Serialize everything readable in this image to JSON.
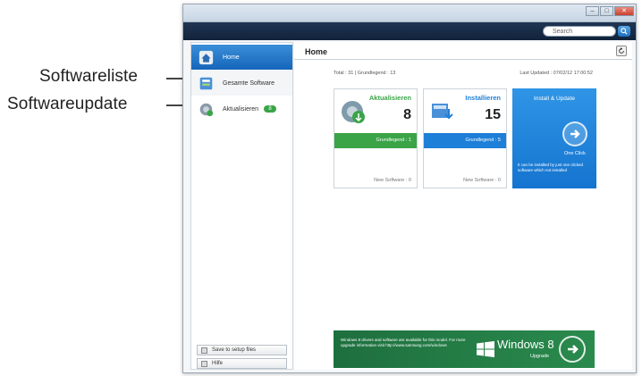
{
  "callouts": {
    "software_list": "Softwareliste",
    "software_update": "Softwareupdate"
  },
  "window": {
    "search_placeholder": "Search"
  },
  "sidebar": {
    "items": [
      {
        "label": "Home",
        "icon": "home-icon"
      },
      {
        "label": "Gesamte Software",
        "icon": "software-list-icon"
      },
      {
        "label": "Aktualisieren",
        "icon": "update-icon",
        "badge": "8"
      }
    ],
    "buttons": [
      {
        "label": "Save to setup files",
        "icon": "save-icon"
      },
      {
        "label": "Hilfe",
        "icon": "help-icon"
      }
    ]
  },
  "main": {
    "title": "Home",
    "total": "Total : 31 | Grundlegend : 13",
    "last_updated": "Last Updated : 07/02/12 17:00:52"
  },
  "cards": {
    "update": {
      "title": "Aktualisieren",
      "count": "8",
      "bar": "Grundlegend : 1",
      "new": "New Software : 0",
      "accent": "#3aa447"
    },
    "install": {
      "title": "Installieren",
      "count": "15",
      "bar": "Grundlegend : 5",
      "new": "New Software : 0",
      "accent": "#1e7fd8"
    },
    "one_click": {
      "title": "Install & Update",
      "label": "One Click",
      "desc": "It can be installed by just one clicked software which not installed"
    }
  },
  "banner": {
    "text": "Windows 8 drivers and software are available for this model. For more upgrade information visit http://www.samsung.com/windows",
    "brand": "Windows 8",
    "sub": "Upgrade"
  }
}
